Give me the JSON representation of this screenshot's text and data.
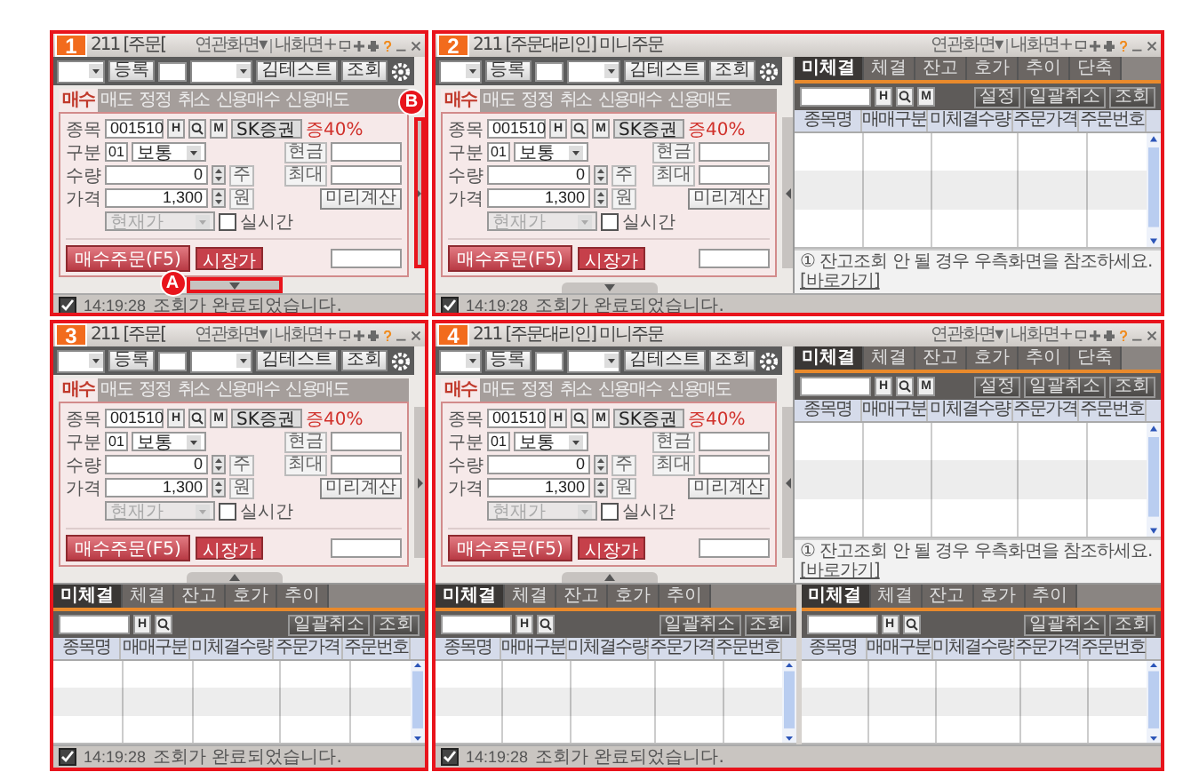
{
  "panels": [
    {
      "number": "1",
      "title": "211 [주문[",
      "related": "연관화면▾",
      "my_screen": "내화면+",
      "side_open": false,
      "bottom_open": false,
      "callouts": [
        {
          "label": "A",
          "kind": "bottom"
        },
        {
          "label": "B",
          "kind": "side"
        }
      ],
      "form": {
        "register": "등록",
        "account": "김테스트",
        "query": "조회",
        "tabs": [
          {
            "label": "매수",
            "selected": true
          },
          {
            "label": "매도",
            "selected": false
          },
          {
            "label": "정정",
            "selected": false
          },
          {
            "label": "취소",
            "selected": false
          },
          {
            "label": "신용매수",
            "selected": false
          },
          {
            "label": "신용매도",
            "selected": false
          }
        ],
        "code_label": "종목",
        "code": "001510",
        "code_buttons": [
          "H",
          "M"
        ],
        "stock_name": "SK증권",
        "margin": "증40%",
        "type_label": "구분",
        "type_code": "01",
        "type_value": "보통",
        "cash_label": "현금",
        "qty_label": "수량",
        "qty": "0",
        "qty_unit": "주",
        "max_label": "최대",
        "price_label": "가격",
        "price": "1,300",
        "price_unit": "원",
        "precalc": "미리계산",
        "price_type": "현재가",
        "realtime_label": "실시간",
        "realtime": false,
        "submit": "매수주문(F5)",
        "market": "시장가"
      },
      "status": {
        "checked": true,
        "time": "14:19:28",
        "message": "조회가 완료되었습니다."
      }
    },
    {
      "number": "2",
      "title": "211 [주문대리인] 미니주문",
      "related": "연관화면▾",
      "my_screen": "내화면+",
      "side_open": true,
      "bottom_open": false,
      "form": {
        "register": "등록",
        "account": "김테스트",
        "query": "조회",
        "tabs": [
          {
            "label": "매수",
            "selected": true
          },
          {
            "label": "매도",
            "selected": false
          },
          {
            "label": "정정",
            "selected": false
          },
          {
            "label": "취소",
            "selected": false
          },
          {
            "label": "신용매수",
            "selected": false
          },
          {
            "label": "신용매도",
            "selected": false
          }
        ],
        "code_label": "종목",
        "code": "001510",
        "code_buttons": [
          "H",
          "M"
        ],
        "stock_name": "SK증권",
        "margin": "증40%",
        "type_label": "구분",
        "type_code": "01",
        "type_value": "보통",
        "cash_label": "현금",
        "qty_label": "수량",
        "qty": "0",
        "qty_unit": "주",
        "max_label": "최대",
        "price_label": "가격",
        "price": "1,300",
        "price_unit": "원",
        "precalc": "미리계산",
        "price_type": "현재가",
        "realtime_label": "실시간",
        "realtime": false,
        "submit": "매수주문(F5)",
        "market": "시장가"
      },
      "side_grid": {
        "tabs": [
          {
            "label": "미체결",
            "selected": true
          },
          {
            "label": "체결",
            "selected": false
          },
          {
            "label": "잔고",
            "selected": false
          },
          {
            "label": "호가",
            "selected": false
          },
          {
            "label": "추이",
            "selected": false
          },
          {
            "label": "단축",
            "selected": false
          }
        ],
        "code_buttons": [
          "H",
          "M"
        ],
        "buttons": [
          "설정",
          "일괄취소",
          "조회"
        ],
        "columns": [
          "종목명",
          "매매구분",
          "미체결수량",
          "주문가격",
          "주문번호"
        ],
        "note": "① 잔고조회 안 될 경우 우측화면을 참조하세요.",
        "note_link": "[바로가기]"
      },
      "status": {
        "checked": true,
        "time": "14:19:28",
        "message": "조회가 완료되었습니다."
      }
    },
    {
      "number": "3",
      "title": "211 [주문[",
      "related": "연관화면▾",
      "my_screen": "내화면+",
      "side_open": false,
      "bottom_open": true,
      "form": {
        "register": "등록",
        "account": "김테스트",
        "query": "조회",
        "tabs": [
          {
            "label": "매수",
            "selected": true
          },
          {
            "label": "매도",
            "selected": false
          },
          {
            "label": "정정",
            "selected": false
          },
          {
            "label": "취소",
            "selected": false
          },
          {
            "label": "신용매수",
            "selected": false
          },
          {
            "label": "신용매도",
            "selected": false
          }
        ],
        "code_label": "종목",
        "code": "001510",
        "code_buttons": [
          "H",
          "M"
        ],
        "stock_name": "SK증권",
        "margin": "증40%",
        "type_label": "구분",
        "type_code": "01",
        "type_value": "보통",
        "cash_label": "현금",
        "qty_label": "수량",
        "qty": "0",
        "qty_unit": "주",
        "max_label": "최대",
        "price_label": "가격",
        "price": "1,300",
        "price_unit": "원",
        "precalc": "미리계산",
        "price_type": "현재가",
        "realtime_label": "실시간",
        "realtime": false,
        "submit": "매수주문(F5)",
        "market": "시장가"
      },
      "bottom_grids": [
        {
          "tabs": [
            {
              "label": "미체결",
              "selected": true
            },
            {
              "label": "체결",
              "selected": false
            },
            {
              "label": "잔고",
              "selected": false
            },
            {
              "label": "호가",
              "selected": false
            },
            {
              "label": "추이",
              "selected": false
            }
          ],
          "code_buttons": [
            "H"
          ],
          "buttons": [
            "일괄취소",
            "조회"
          ],
          "columns": [
            "종목명",
            "매매구분",
            "미체결수량",
            "주문가격",
            "주문번호"
          ]
        }
      ],
      "status": {
        "checked": true,
        "time": "14:19:28",
        "message": "조회가 완료되었습니다."
      }
    },
    {
      "number": "4",
      "title": "211 [주문대리인] 미니주문",
      "related": "연관화면▾",
      "my_screen": "내화면+",
      "side_open": true,
      "bottom_open": true,
      "form": {
        "register": "등록",
        "account": "김테스트",
        "query": "조회",
        "tabs": [
          {
            "label": "매수",
            "selected": true
          },
          {
            "label": "매도",
            "selected": false
          },
          {
            "label": "정정",
            "selected": false
          },
          {
            "label": "취소",
            "selected": false
          },
          {
            "label": "신용매수",
            "selected": false
          },
          {
            "label": "신용매도",
            "selected": false
          }
        ],
        "code_label": "종목",
        "code": "001510",
        "code_buttons": [
          "H",
          "M"
        ],
        "stock_name": "SK증권",
        "margin": "증40%",
        "type_label": "구분",
        "type_code": "01",
        "type_value": "보통",
        "cash_label": "현금",
        "qty_label": "수량",
        "qty": "0",
        "qty_unit": "주",
        "max_label": "최대",
        "price_label": "가격",
        "price": "1,300",
        "price_unit": "원",
        "precalc": "미리계산",
        "price_type": "현재가",
        "realtime_label": "실시간",
        "realtime": false,
        "submit": "매수주문(F5)",
        "market": "시장가"
      },
      "side_grid": {
        "tabs": [
          {
            "label": "미체결",
            "selected": true
          },
          {
            "label": "체결",
            "selected": false
          },
          {
            "label": "잔고",
            "selected": false
          },
          {
            "label": "호가",
            "selected": false
          },
          {
            "label": "추이",
            "selected": false
          },
          {
            "label": "단축",
            "selected": false
          }
        ],
        "code_buttons": [
          "H",
          "M"
        ],
        "buttons": [
          "설정",
          "일괄취소",
          "조회"
        ],
        "columns": [
          "종목명",
          "매매구분",
          "미체결수량",
          "주문가격",
          "주문번호"
        ],
        "note": "① 잔고조회 안 될 경우 우측화면을 참조하세요.",
        "note_link": "[바로가기]"
      },
      "bottom_grids": [
        {
          "tabs": [
            {
              "label": "미체결",
              "selected": true
            },
            {
              "label": "체결",
              "selected": false
            },
            {
              "label": "잔고",
              "selected": false
            },
            {
              "label": "호가",
              "selected": false
            },
            {
              "label": "추이",
              "selected": false
            }
          ],
          "code_buttons": [
            "H"
          ],
          "buttons": [
            "일괄취소",
            "조회"
          ],
          "columns": [
            "종목명",
            "매매구분",
            "미체결수량",
            "주문가격",
            "주문번호"
          ]
        },
        {
          "tabs": [
            {
              "label": "미체결",
              "selected": true
            },
            {
              "label": "체결",
              "selected": false
            },
            {
              "label": "잔고",
              "selected": false
            },
            {
              "label": "호가",
              "selected": false
            },
            {
              "label": "추이",
              "selected": false
            }
          ],
          "code_buttons": [
            "H"
          ],
          "buttons": [
            "일괄취소",
            "조회"
          ],
          "columns": [
            "종목명",
            "매매구분",
            "미체결수량",
            "주문가격",
            "주문번호"
          ]
        }
      ],
      "status": {
        "checked": true,
        "time": "14:19:28",
        "message": "조회가 완료되었습니다."
      }
    }
  ]
}
